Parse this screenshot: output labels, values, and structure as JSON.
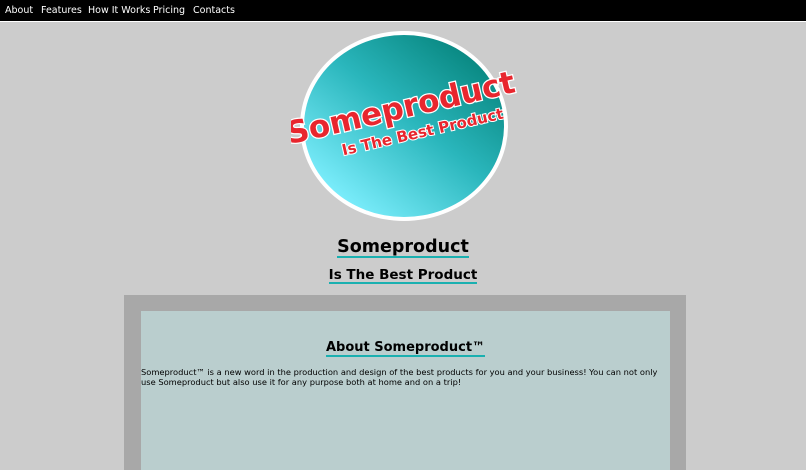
{
  "nav": {
    "items": [
      {
        "label": "About"
      },
      {
        "label": "Features"
      },
      {
        "label": "How It Works"
      },
      {
        "label": "Pricing"
      },
      {
        "label": "Contacts"
      }
    ]
  },
  "logo": {
    "name": "Someproduct",
    "tagline": "Is The Best Product"
  },
  "hero": {
    "title": "Someproduct",
    "subtitle": "Is The Best Product"
  },
  "about": {
    "title": "About Someproduct™",
    "text": "Someproduct™ is a new word in the production and design of the best products for you and your business! You can not only use Someproduct but also use it for any purpose both at home and on a trip!"
  },
  "colors": {
    "nav_bg": "#000000",
    "page_bg": "#cccccc",
    "accent_underline": "#1ab0b0",
    "logo_red": "#e8262e",
    "about_frame": "#a8a8a8",
    "about_panel": "#bacece"
  }
}
